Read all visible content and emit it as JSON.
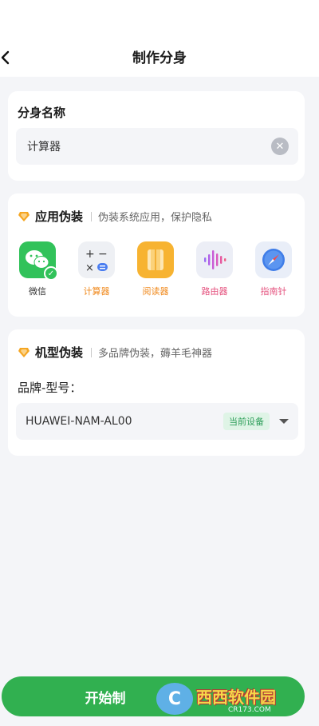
{
  "header": {
    "title": "制作分身"
  },
  "clone_name": {
    "label": "分身名称",
    "value": "计算器"
  },
  "app_disguise": {
    "title": "应用伪装",
    "desc": "伪装系统应用，保护隐私",
    "apps": [
      {
        "label": "微信",
        "icon": "wechat-icon",
        "selected": true
      },
      {
        "label": "计算器",
        "icon": "calculator-icon"
      },
      {
        "label": "阅读器",
        "icon": "reader-icon"
      },
      {
        "label": "路由器",
        "icon": "voice-wave-icon"
      },
      {
        "label": "指南针",
        "icon": "compass-icon"
      }
    ]
  },
  "model_disguise": {
    "title": "机型伪装",
    "desc": "多品牌伪装，薅羊毛神器",
    "brand_label": "品牌-型号：",
    "selected_model": "HUAWEI-NAM-AL00",
    "current_badge": "当前设备"
  },
  "footer": {
    "start_label": "开始制"
  },
  "watermark": {
    "main": "西西软件园",
    "sub": "CR173.COM",
    "logo_letter": "C"
  },
  "colors": {
    "accent_green": "#31b050",
    "accent_orange": "#f08a1e",
    "background": "#f4f5f8"
  }
}
